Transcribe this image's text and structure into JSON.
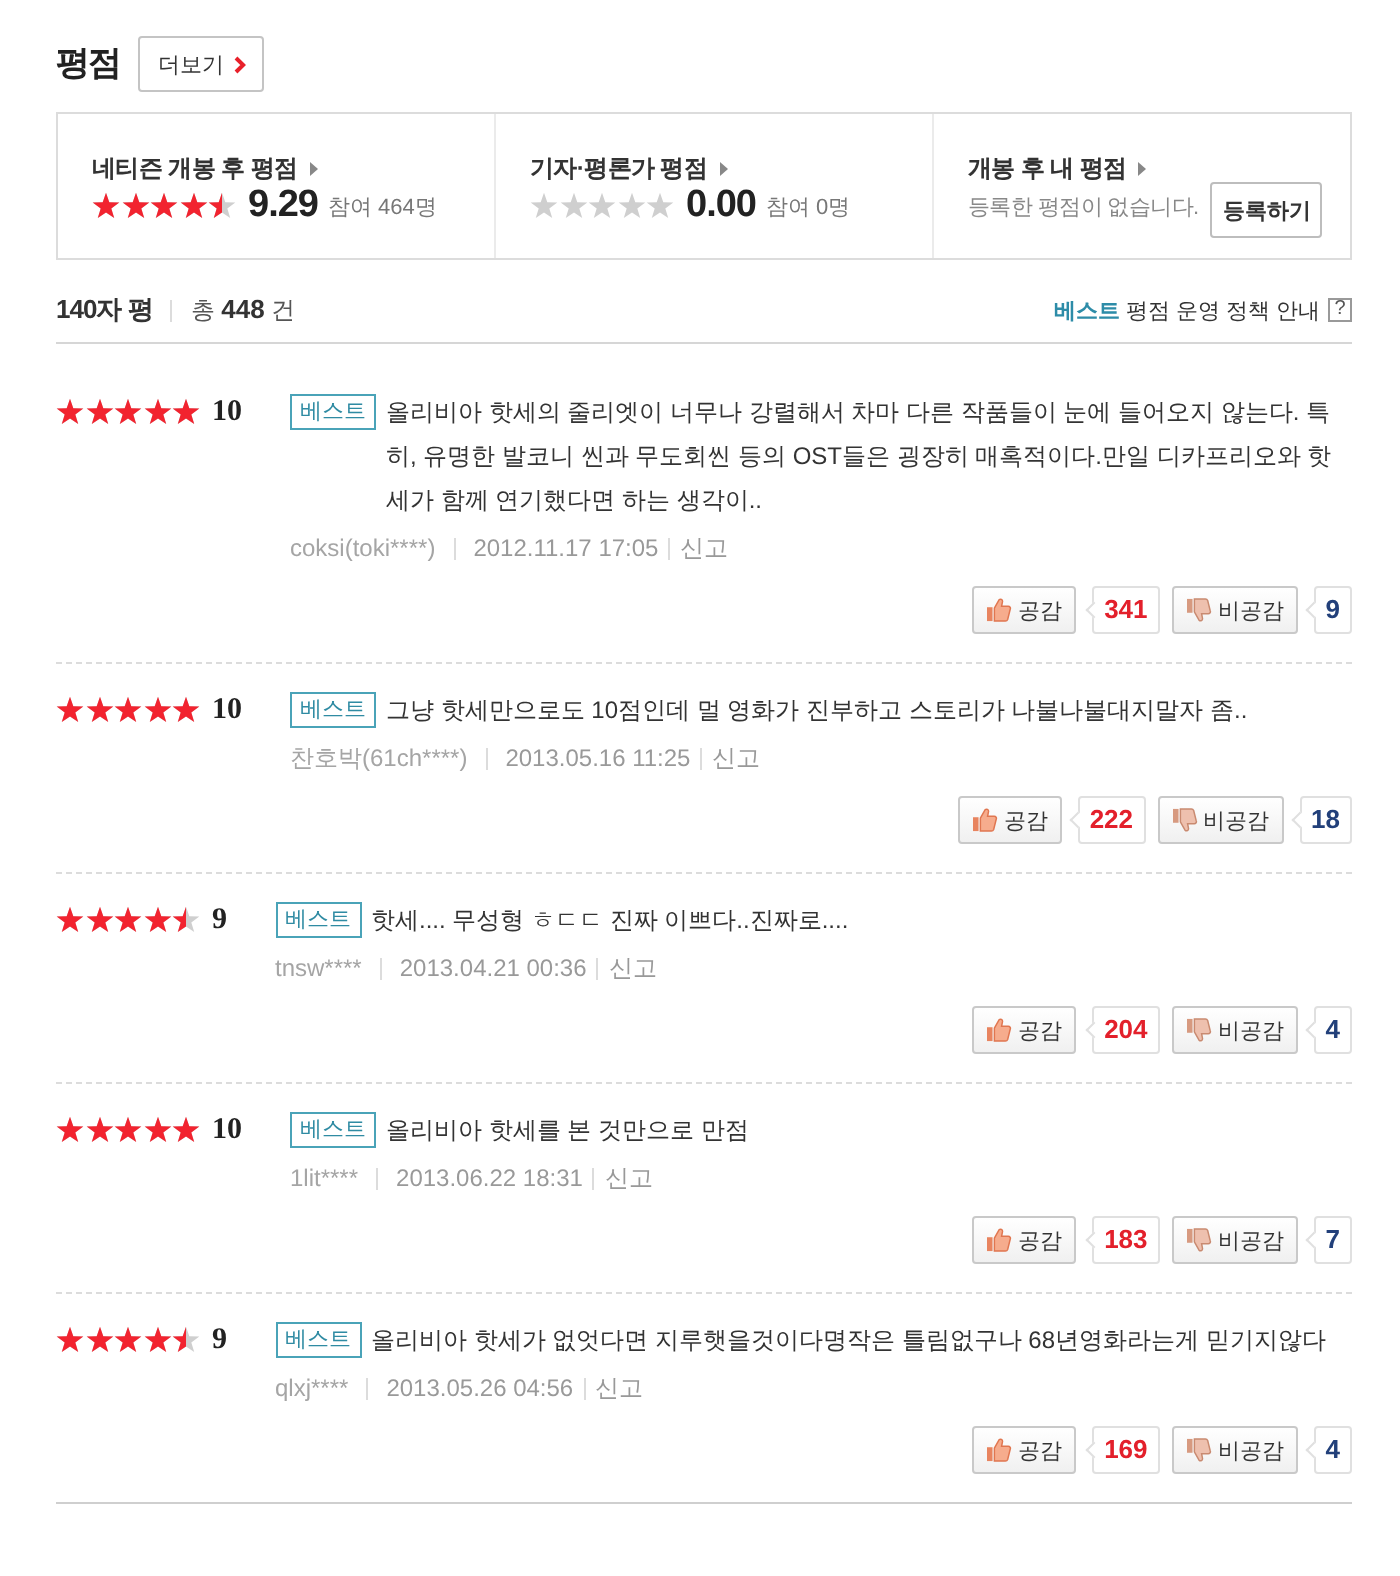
{
  "section": {
    "title": "평점",
    "more_button": "더보기"
  },
  "summary": [
    {
      "kind": "score",
      "title": "네티즌 개봉 후 평점",
      "stars": 4.5,
      "score": "9.29",
      "participants": "참여 464명"
    },
    {
      "kind": "score",
      "title": "기자·평론가 평점",
      "stars": 0,
      "score": "0.00",
      "participants": "참여 0명"
    },
    {
      "kind": "mine",
      "title": "개봉 후 내 평점",
      "message": "등록한 평점이 없습니다.",
      "button": "등록하기"
    }
  ],
  "list_header": {
    "title": "140자 평",
    "total": "총 **448** 건",
    "policy": "**베스트** 평점 운영 정책 안내",
    "help": "?"
  },
  "reviews": [
    {
      "stars": 5,
      "score": "10",
      "badge": "베스트",
      "text": "올리비아 핫세의 줄리엣이 너무나 강렬해서 차마 다른 작품들이 눈에 들어오지 않는다. 특히, 유명한 발코니 씬과 무도회씬 등의 OST들은 굉장히 매혹적이다.만일 디카프리오와 핫세가 함께 연기했다면 하는 생각이..",
      "author": "coksi(toki****)",
      "date": "2012.11.17 17:05",
      "report": "신고",
      "like_label": "공감",
      "likes": "341",
      "dislike_label": "비공감",
      "dislikes": "9"
    },
    {
      "stars": 5,
      "score": "10",
      "badge": "베스트",
      "text": "그냥 핫세만으로도 10점인데 멀 영화가 진부하고 스토리가 나불나불대지말자 좀..",
      "author": "찬호박(61ch****)",
      "date": "2013.05.16 11:25",
      "report": "신고",
      "like_label": "공감",
      "likes": "222",
      "dislike_label": "비공감",
      "dislikes": "18"
    },
    {
      "stars": 4.5,
      "score": "9",
      "badge": "베스트",
      "text": "핫세.... 무성형 ㅎㄷㄷ 진짜 이쁘다..진짜로....",
      "author": "tnsw****",
      "date": "2013.04.21 00:36",
      "report": "신고",
      "like_label": "공감",
      "likes": "204",
      "dislike_label": "비공감",
      "dislikes": "4"
    },
    {
      "stars": 5,
      "score": "10",
      "badge": "베스트",
      "text": "올리비아 핫세를 본 것만으로 만점",
      "author": "1lit****",
      "date": "2013.06.22 18:31",
      "report": "신고",
      "like_label": "공감",
      "likes": "183",
      "dislike_label": "비공감",
      "dislikes": "7"
    },
    {
      "stars": 4.5,
      "score": "9",
      "badge": "베스트",
      "text": "올리비아 핫세가 없엇다면 지루햇을것이다명작은 틀림없구나 68년영화라는게 믿기지않다",
      "author": "qlxj****",
      "date": "2013.05.26 04:56",
      "report": "신고",
      "like_label": "공감",
      "likes": "169",
      "dislike_label": "비공감",
      "dislikes": "4"
    }
  ]
}
